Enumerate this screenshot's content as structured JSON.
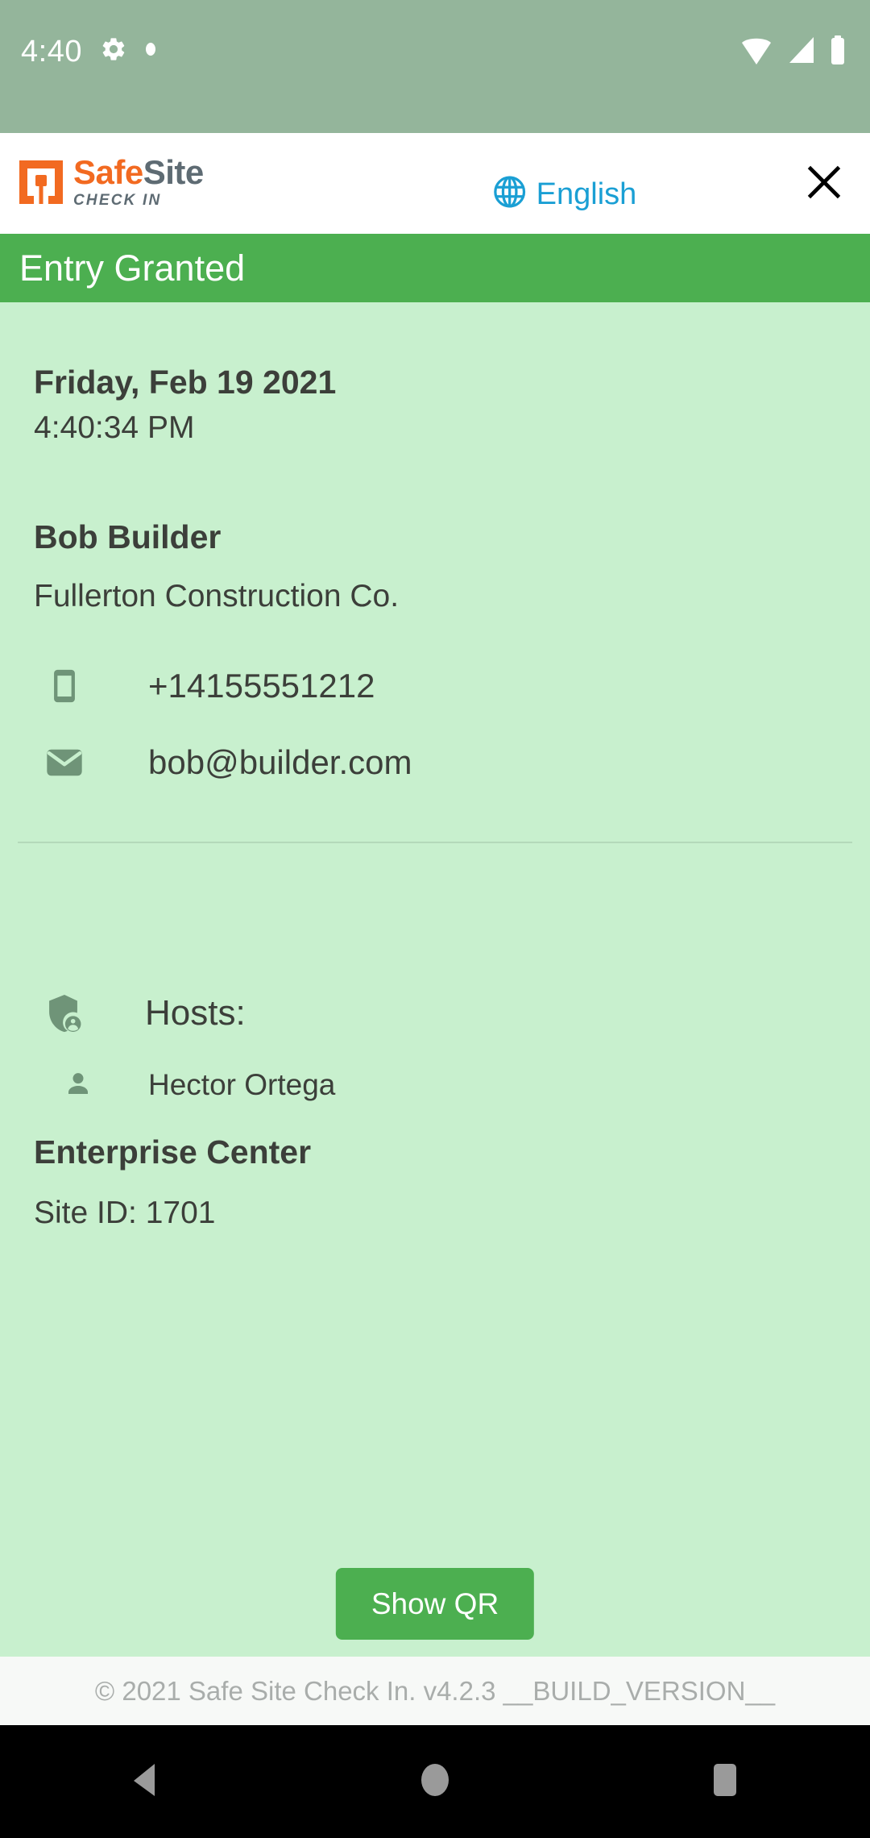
{
  "status_bar": {
    "clock": "4:40",
    "icons": [
      "gear-icon",
      "dot-icon",
      "wifi-icon",
      "cellular-signal-icon",
      "battery-icon"
    ]
  },
  "header": {
    "brand": {
      "word_safe": "Safe",
      "word_site": "Site",
      "tagline": "CHECK IN",
      "mark": "safesite-logo-icon",
      "orange": "#f26a21",
      "gray": "#5e6b73"
    },
    "language": {
      "label": "English",
      "icon": "globe-icon",
      "color": "#1a9fd4"
    },
    "close": {
      "icon": "close-icon"
    }
  },
  "banner": {
    "text": "Entry Granted",
    "background": "#4caf50",
    "text_color": "#ffffff"
  },
  "visit": {
    "date": "Friday, Feb 19 2021",
    "time": "4:40:34 PM"
  },
  "visitor": {
    "name": "Bob Builder",
    "company": "Fullerton Construction Co.",
    "phone": "+14155551212",
    "phone_icon": "phone-icon",
    "email": "bob@builder.com",
    "email_icon": "email-icon"
  },
  "hosts": {
    "label": "Hosts:",
    "icon": "shield-person-icon",
    "list": [
      {
        "name": "Hector Ortega",
        "icon": "person-icon"
      }
    ]
  },
  "site": {
    "name": "Enterprise Center",
    "id_label": "Site ID: 1701"
  },
  "actions": {
    "show_qr": "Show QR"
  },
  "footer": {
    "text": "© 2021 Safe Site Check In. v4.2.3 __BUILD_VERSION__"
  },
  "nav_bar": {
    "back": "back-triangle-icon",
    "home": "home-circle-icon",
    "recents": "recents-square-icon"
  },
  "theme": {
    "status_bar_bg": "#94b59b",
    "content_bg": "#c8f0ce",
    "accent_green": "#4caf50",
    "text_dark": "#3c3f3a"
  }
}
